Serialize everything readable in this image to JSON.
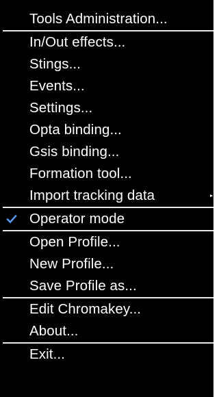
{
  "menu": {
    "items": [
      {
        "label": "Tools Administration..."
      },
      {
        "label": "In/Out effects..."
      },
      {
        "label": "Stings..."
      },
      {
        "label": "Events..."
      },
      {
        "label": "Settings..."
      },
      {
        "label": "Opta binding..."
      },
      {
        "label": "Gsis binding..."
      },
      {
        "label": "Formation tool..."
      },
      {
        "label": "Import tracking data",
        "has_submenu": true
      },
      {
        "label": "Operator mode",
        "checked": true
      },
      {
        "label": "Open Profile..."
      },
      {
        "label": "New Profile..."
      },
      {
        "label": "Save Profile as..."
      },
      {
        "label": "Edit Chromakey..."
      },
      {
        "label": "About..."
      },
      {
        "label": "Exit..."
      }
    ]
  },
  "colors": {
    "background": "#000000",
    "text": "#ffffff",
    "separator": "#e8e8e8",
    "check_accent": "#5aa0ff"
  },
  "icons": {
    "check": "checkmark-icon",
    "submenu": "chevron-right-icon"
  }
}
